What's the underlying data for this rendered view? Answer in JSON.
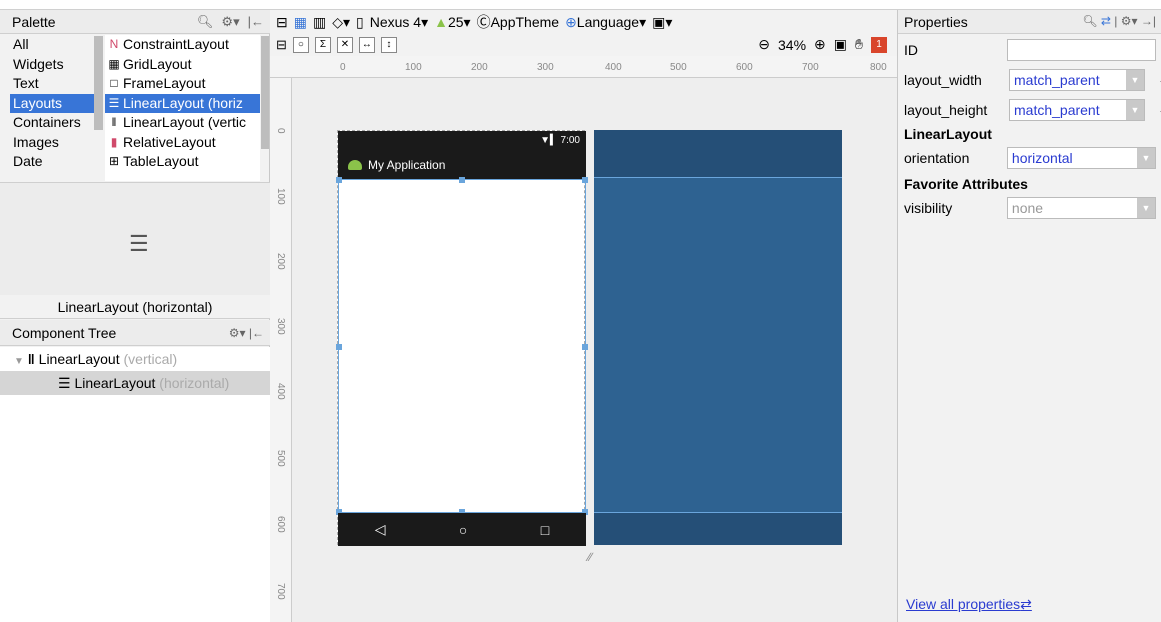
{
  "palette": {
    "title": "Palette",
    "categories": [
      "All",
      "Widgets",
      "Text",
      "Layouts",
      "Containers",
      "Images",
      "Date"
    ],
    "selected_category": "Layouts",
    "items": [
      {
        "icon": "constraint-layout-icon",
        "label": "ConstraintLayout"
      },
      {
        "icon": "grid-layout-icon",
        "label": "GridLayout"
      },
      {
        "icon": "frame-layout-icon",
        "label": "FrameLayout"
      },
      {
        "icon": "linear-horizontal-icon",
        "label": "LinearLayout (horiz"
      },
      {
        "icon": "linear-vertical-icon",
        "label": "LinearLayout (vertic"
      },
      {
        "icon": "relative-layout-icon",
        "label": "RelativeLayout"
      },
      {
        "icon": "table-layout-icon",
        "label": "TableLayout"
      }
    ],
    "preview_label": "LinearLayout (horizontal)"
  },
  "component_tree": {
    "title": "Component Tree",
    "root": {
      "label": "LinearLayout",
      "hint": "(vertical)"
    },
    "child": {
      "label": "LinearLayout",
      "hint": "(horizontal)"
    }
  },
  "toolbar": {
    "device": "Nexus 4",
    "api": "25",
    "theme": "AppTheme",
    "language": "Language",
    "zoom": "34%"
  },
  "ruler": {
    "h": [
      "0",
      "100",
      "200",
      "300",
      "400",
      "500",
      "600",
      "700",
      "800"
    ],
    "v": [
      "0",
      "100",
      "200",
      "300",
      "400",
      "500",
      "600",
      "700"
    ]
  },
  "phone": {
    "time": "7:00",
    "app_title": "My Application"
  },
  "properties": {
    "title": "Properties",
    "id_label": "ID",
    "id_value": "",
    "layout_width_label": "layout_width",
    "layout_width_value": "match_parent",
    "layout_height_label": "layout_height",
    "layout_height_value": "match_parent",
    "section_linear": "LinearLayout",
    "orientation_label": "orientation",
    "orientation_value": "horizontal",
    "section_fav": "Favorite Attributes",
    "visibility_label": "visibility",
    "visibility_value": "none",
    "view_all": "View all properties"
  },
  "colors": {
    "selection": "#3875d7",
    "blueprint": "#2e6291",
    "link": "#2a3bd0",
    "warning": "#d9452b"
  },
  "warnings_count": "1"
}
